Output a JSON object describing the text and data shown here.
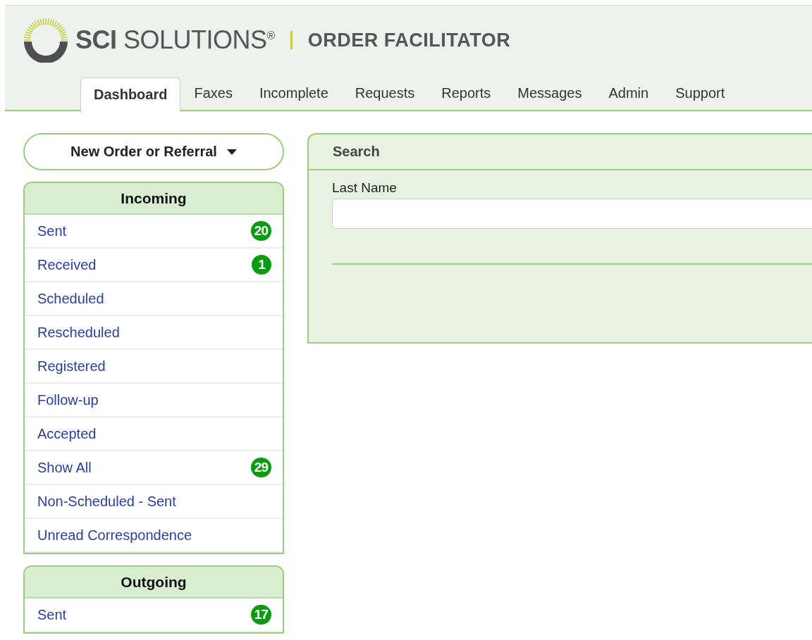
{
  "header": {
    "brand": "**SCI** SOLUTIONS$^{®}$",
    "product": "ORDER FACILITATOR"
  },
  "tabs": [
    {
      "label": "Dashboard",
      "selected": true
    },
    {
      "label": "Faxes",
      "selected": false
    },
    {
      "label": "Incomplete",
      "selected": false
    },
    {
      "label": "Requests",
      "selected": false
    },
    {
      "label": "Reports",
      "selected": false
    },
    {
      "label": "Messages",
      "selected": false
    },
    {
      "label": "Admin",
      "selected": false
    },
    {
      "label": "Support",
      "selected": false
    }
  ],
  "new_button": {
    "label": "New Order or Referral"
  },
  "panels": [
    {
      "title": "Incoming",
      "items": [
        {
          "label": "Sent",
          "count": "20"
        },
        {
          "label": "Received",
          "count": "1"
        },
        {
          "label": "Scheduled"
        },
        {
          "label": "Rescheduled"
        },
        {
          "label": "Registered"
        },
        {
          "label": "Follow-up"
        },
        {
          "label": "Accepted"
        },
        {
          "label": "Show All",
          "count": "29"
        },
        {
          "label": "Non-Scheduled - Sent"
        },
        {
          "label": "Unread Correspondence"
        }
      ]
    },
    {
      "title": "Outgoing",
      "items": [
        {
          "label": "Sent",
          "count": "17"
        }
      ]
    }
  ],
  "search": {
    "title": "Search",
    "fields": [
      {
        "label": "Last Name"
      }
    ]
  }
}
